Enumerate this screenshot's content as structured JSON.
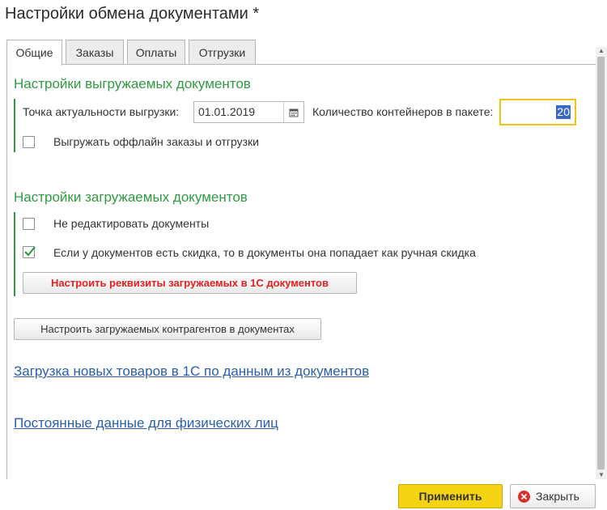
{
  "window": {
    "title": "Настройки обмена документами *"
  },
  "tabs": [
    {
      "label": "Общие"
    },
    {
      "label": "Заказы"
    },
    {
      "label": "Оплаты"
    },
    {
      "label": "Отгрузки"
    }
  ],
  "export_section": {
    "title": "Настройки выгружаемых документов",
    "actuality_label": "Точка актуальности выгрузки:",
    "actuality_value": "01.01.2019",
    "containers_label": "Количество контейнеров в пакете:",
    "containers_value": "20",
    "offline_checkbox": {
      "label": "Выгружать оффлайн заказы и отгрузки",
      "checked": false
    }
  },
  "import_section": {
    "title": "Настройки загружаемых документов",
    "no_edit_checkbox": {
      "label": "Не редактировать документы",
      "checked": false
    },
    "discount_checkbox": {
      "label": "Если у документов есть скидка, то в документы она попадает как ручная скидка",
      "checked": true
    },
    "configure_props_button": "Настроить реквизиты загружаемых в 1С документов"
  },
  "configure_agents_button": "Настроить загружаемых контрагентов в документах",
  "links": {
    "new_goods": "Загрузка новых товаров в 1С по данным из документов",
    "personal_data": "Постоянные данные для физических лиц"
  },
  "footer": {
    "apply": "Применить",
    "close": "Закрыть"
  },
  "colors": {
    "section_green": "#2f9a42",
    "link_blue": "#2b5fa8",
    "apply_yellow": "#f5d415",
    "alert_red": "#e32121"
  }
}
